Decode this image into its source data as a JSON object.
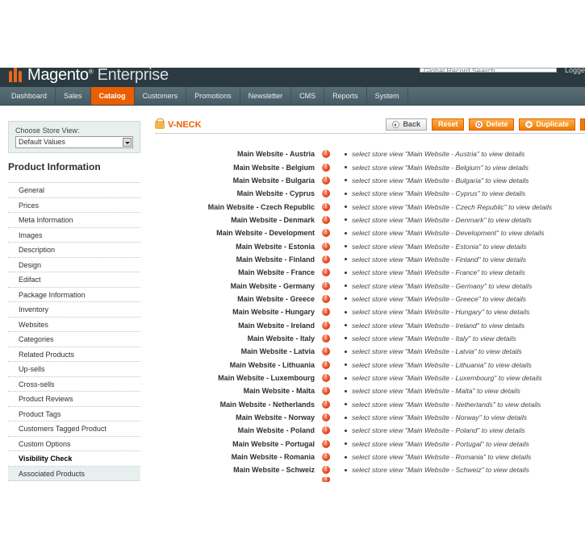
{
  "header": {
    "brand": "Magento",
    "brand_suffix": "Enterprise",
    "search_placeholder": "Global Record Search",
    "logged_text": "Logge"
  },
  "nav": {
    "items": [
      {
        "label": "Dashboard"
      },
      {
        "label": "Sales"
      },
      {
        "label": "Catalog"
      },
      {
        "label": "Customers"
      },
      {
        "label": "Promotions"
      },
      {
        "label": "Newsletter"
      },
      {
        "label": "CMS"
      },
      {
        "label": "Reports"
      },
      {
        "label": "System"
      }
    ],
    "active": "Catalog"
  },
  "sidebar": {
    "store_label": "Choose Store View:",
    "store_value": "Default Values",
    "section_title": "Product Information",
    "tabs": [
      "General",
      "Prices",
      "Meta Information",
      "Images",
      "Description",
      "Design",
      "Edifact",
      "Package Information",
      "Inventory",
      "Websites",
      "Categories",
      "Related Products",
      "Up-sells",
      "Cross-sells",
      "Product Reviews",
      "Product Tags",
      "Customers Tagged Product",
      "Custom Options",
      "Visibility Check",
      "Associated Products"
    ],
    "active_tab": "Visibility Check"
  },
  "main": {
    "title": "V-NECK",
    "buttons": {
      "back": "Back",
      "reset": "Reset",
      "delete": "Delete",
      "duplicate": "Duplicate"
    },
    "rows": [
      {
        "label": "Main Website - Austria",
        "msg": "select store view \"Main Website - Austria\" to view details"
      },
      {
        "label": "Main Website - Belgium",
        "msg": "select store view \"Main Website - Belgium\" to view details"
      },
      {
        "label": "Main Website - Bulgaria",
        "msg": "select store view \"Main Website - Bulgaria\" to view details"
      },
      {
        "label": "Main Website - Cyprus",
        "msg": "select store view \"Main Website - Cyprus\" to view details"
      },
      {
        "label": "Main Website - Czech Republic",
        "msg": "select store view \"Main Website - Czech Republic\" to view details"
      },
      {
        "label": "Main Website - Denmark",
        "msg": "select store view \"Main Website - Denmark\" to view details"
      },
      {
        "label": "Main Website - Development",
        "msg": "select store view \"Main Website - Development\" to view details"
      },
      {
        "label": "Main Website - Estonia",
        "msg": "select store view \"Main Website - Estonia\" to view details"
      },
      {
        "label": "Main Website - Finland",
        "msg": "select store view \"Main Website - Finland\" to view details"
      },
      {
        "label": "Main Website - France",
        "msg": "select store view \"Main Website - France\" to view details"
      },
      {
        "label": "Main Website - Germany",
        "msg": "select store view \"Main Website - Germany\" to view details"
      },
      {
        "label": "Main Website - Greece",
        "msg": "select store view \"Main Website - Greece\" to view details"
      },
      {
        "label": "Main Website - Hungary",
        "msg": "select store view \"Main Website - Hungary\" to view details"
      },
      {
        "label": "Main Website - Ireland",
        "msg": "select store view \"Main Website - Ireland\" to view details"
      },
      {
        "label": "Main Website - Italy",
        "msg": "select store view \"Main Website - Italy\" to view details"
      },
      {
        "label": "Main Website - Latvia",
        "msg": "select store view \"Main Website - Latvia\" to view details"
      },
      {
        "label": "Main Website - Lithuania",
        "msg": "select store view \"Main Website - Lithuania\" to view details"
      },
      {
        "label": "Main Website - Luxembourg",
        "msg": "select store view \"Main Website - Luxembourg\" to view details"
      },
      {
        "label": "Main Website - Malta",
        "msg": "select store view \"Main Website - Malta\" to view details"
      },
      {
        "label": "Main Website - Netherlands",
        "msg": "select store view \"Main Website - Netherlands\" to view details"
      },
      {
        "label": "Main Website - Norway",
        "msg": "select store view \"Main Website - Norway\" to view details"
      },
      {
        "label": "Main Website - Poland",
        "msg": "select store view \"Main Website - Poland\" to view details"
      },
      {
        "label": "Main Website - Portugal",
        "msg": "select store view \"Main Website - Portugal\" to view details"
      },
      {
        "label": "Main Website - Romania",
        "msg": "select store view \"Main Website - Romania\" to view details"
      },
      {
        "label": "Main Website - Schweiz",
        "msg": "select store view \"Main Website - Schweiz\" to view details"
      }
    ]
  },
  "colors": {
    "accent": "#eb5e00",
    "header_bg": "#2a3a40",
    "nav_bg": "#4f636b",
    "warning": "#e03a12"
  }
}
